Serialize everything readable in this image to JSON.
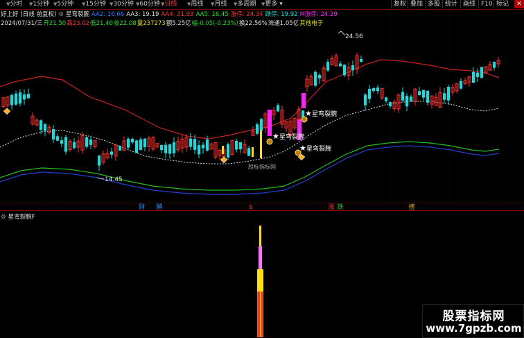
{
  "toolbar": {
    "periods": [
      {
        "label": "分时"
      },
      {
        "label": "1分钟"
      },
      {
        "label": "5分钟"
      },
      {
        "label": "15分钟"
      },
      {
        "label": "30分钟"
      },
      {
        "label": "60分钟"
      },
      {
        "label": "日线"
      },
      {
        "label": "周线"
      },
      {
        "label": "月线"
      },
      {
        "label": "多周期"
      },
      {
        "label": "更多"
      }
    ],
    "right_buttons": [
      {
        "label": "复权"
      },
      {
        "label": "叠加"
      },
      {
        "label": "多股"
      },
      {
        "label": "统计"
      },
      {
        "label": "画线"
      },
      {
        "label": "F10"
      },
      {
        "label": "标记"
      }
    ],
    "close_label": "✕"
  },
  "info1": {
    "stock": "好上好",
    "mode": "(日线 前复权)",
    "indicator": "星弯裂腕",
    "aa2": "AA2: 16.66",
    "aa3": "AA3: 19.19",
    "aa4": "AA4: 21.93",
    "aa5": "AA5: 16.45",
    "zhangting": "涨停: 24.34",
    "dieting": "跌停: 19.92",
    "mzhangting": "M涨停: 24.29"
  },
  "info2": {
    "date": "2024/07/31/三",
    "open": "开21.50",
    "high": "高23.02",
    "low": "低21.40",
    "close": "收22.08",
    "vol": "量237273",
    "amount": "额5.25亿",
    "change": "幅-0.05(-0.23%)",
    "turnover": "换22.56%",
    "float": "流通1.05亿",
    "sector": "其他电子"
  },
  "annotations": {
    "high_label": "24.56",
    "low_label": "14.45",
    "signal_label": "星弯裂腕",
    "watermark_center": "股标指标网"
  },
  "markers": [
    {
      "label": "财"
    },
    {
      "label": "解"
    },
    {
      "label": "$"
    },
    {
      "label": "涨"
    },
    {
      "label": "跌"
    },
    {
      "label": "榜"
    }
  ],
  "sub_panel": {
    "title": "星弯裂腕F"
  },
  "watermark": {
    "line1": "股票指标网",
    "line2": "www.7gpzb.com"
  },
  "colors": {
    "up": "#ff3030",
    "down": "#00e5e5",
    "upper_band": "#c82020",
    "lower_band_green": "#20c020",
    "lower_band_blue": "#2040d0",
    "mid_dash": "#e0e0e0",
    "signal_magenta": "#ff20ff",
    "signal_yellow": "#ffe000"
  }
}
